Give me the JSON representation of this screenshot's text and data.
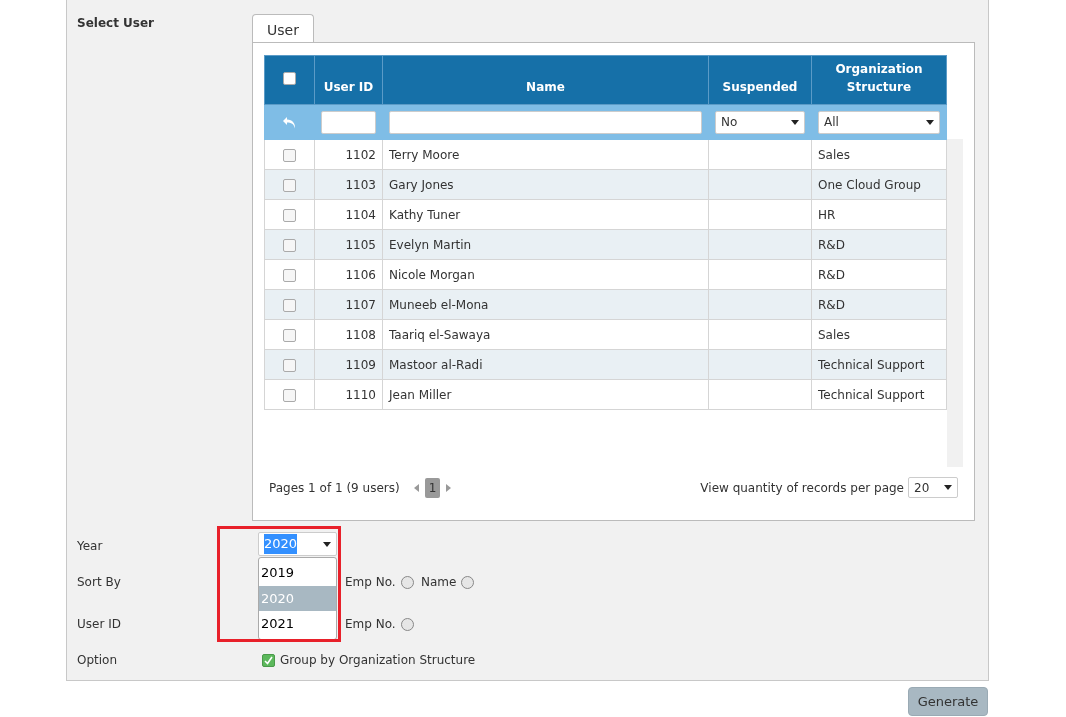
{
  "section_label": "Select User",
  "tabs": [
    {
      "label": "User",
      "selected": true
    }
  ],
  "table": {
    "select_all_checked": false,
    "columns": [
      "User ID",
      "Name",
      "Suspended",
      "Organization Structure"
    ],
    "filters": {
      "suspended": "No",
      "organization_structure": "All"
    },
    "rows": [
      {
        "checked": false,
        "user_id": "1102",
        "name": "Terry Moore",
        "organization_structure": "Sales"
      },
      {
        "checked": false,
        "user_id": "1103",
        "name": "Gary Jones",
        "organization_structure": "One Cloud Group"
      },
      {
        "checked": false,
        "user_id": "1104",
        "name": "Kathy Tuner",
        "organization_structure": "HR"
      },
      {
        "checked": false,
        "user_id": "1105",
        "name": "Evelyn Martin",
        "organization_structure": "R&D"
      },
      {
        "checked": false,
        "user_id": "1106",
        "name": "Nicole Morgan",
        "organization_structure": "R&D"
      },
      {
        "checked": false,
        "user_id": "1107",
        "name": "Muneeb el-Mona",
        "organization_structure": "R&D"
      },
      {
        "checked": false,
        "user_id": "1108",
        "name": "Taariq el-Sawaya",
        "organization_structure": "Sales"
      },
      {
        "checked": false,
        "user_id": "1109",
        "name": "Mastoor al-Radi",
        "organization_structure": "Technical Support"
      },
      {
        "checked": false,
        "user_id": "1110",
        "name": "Jean Miller",
        "organization_structure": "Technical Support"
      }
    ]
  },
  "pagination": {
    "summary": "Pages 1 of 1 (9 users)",
    "pages": [
      {
        "label": "1",
        "selected": true
      }
    ],
    "per_page_label": "View quantity of records per page",
    "per_page": "20"
  },
  "form": {
    "year": {
      "label": "Year",
      "value": "2020",
      "options": [
        {
          "label": "2019",
          "selected": false
        },
        {
          "label": "2020",
          "selected": true
        },
        {
          "label": "2021",
          "selected": false
        }
      ]
    },
    "sort_by": {
      "label": "Sort By",
      "options": [
        {
          "label": "Emp No.",
          "selected": false
        },
        {
          "label": "Name",
          "selected": false
        }
      ]
    },
    "user_id": {
      "label": "User ID",
      "options": [
        {
          "label": "Emp No.",
          "selected": false
        }
      ]
    },
    "option": {
      "label": "Option",
      "checkbox": {
        "label": "Group by Organization Structure",
        "checked": true
      }
    }
  },
  "generate_button": "Generate"
}
